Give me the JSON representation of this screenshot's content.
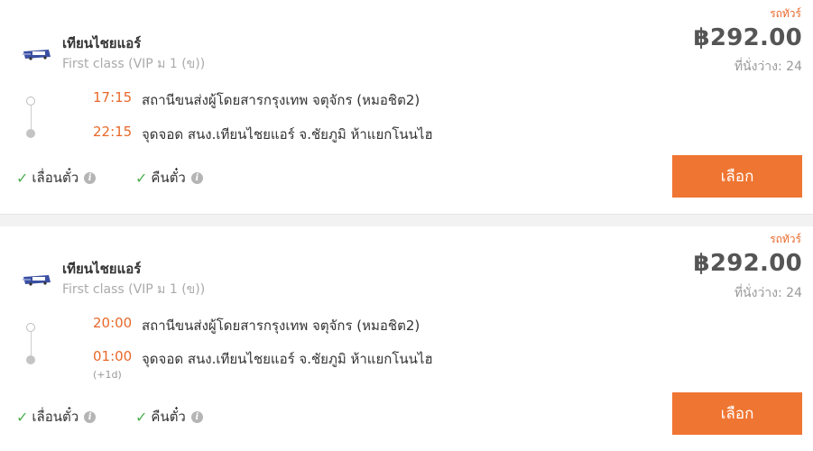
{
  "currency_symbol": "฿",
  "select_label": "เลือก",
  "features": [
    {
      "label": "เลื่อนตั๋ว"
    },
    {
      "label": "คืนตั๋ว"
    }
  ],
  "trips": [
    {
      "badge": "รถทัวร์",
      "operator": "เทียนไชยแอร์",
      "class": "First class (VIP ม 1 (ข))",
      "price": "฿292.00",
      "seats": "ที่นั่งว่าง: 24",
      "depart_time": "17:15",
      "depart_place": "สถานีขนส่งผู้โดยสารกรุงเทพ จตุจักร (หมอชิต2)",
      "arrive_time": "22:15",
      "arrive_place": "จุดจอด สนง.เทียนไชยแอร์ จ.ชัยภูมิ ห้าแยกโนนไฮ",
      "arrive_day": ""
    },
    {
      "badge": "รถทัวร์",
      "operator": "เทียนไชยแอร์",
      "class": "First class (VIP ม 1 (ข))",
      "price": "฿292.00",
      "seats": "ที่นั่งว่าง: 24",
      "depart_time": "20:00",
      "depart_place": "สถานีขนส่งผู้โดยสารกรุงเทพ จตุจักร (หมอชิต2)",
      "arrive_time": "01:00",
      "arrive_place": "จุดจอด สนง.เทียนไชยแอร์ จ.ชัยภูมิ ห้าแยกโนนไฮ",
      "arrive_day": "(+1d)"
    }
  ],
  "colors": {
    "accent": "#ef7532",
    "time": "#e8692b",
    "check": "#4caf50"
  },
  "icons": {
    "operator_logo": "bus-operator-logo",
    "check": "check-icon",
    "info": "info-icon"
  }
}
